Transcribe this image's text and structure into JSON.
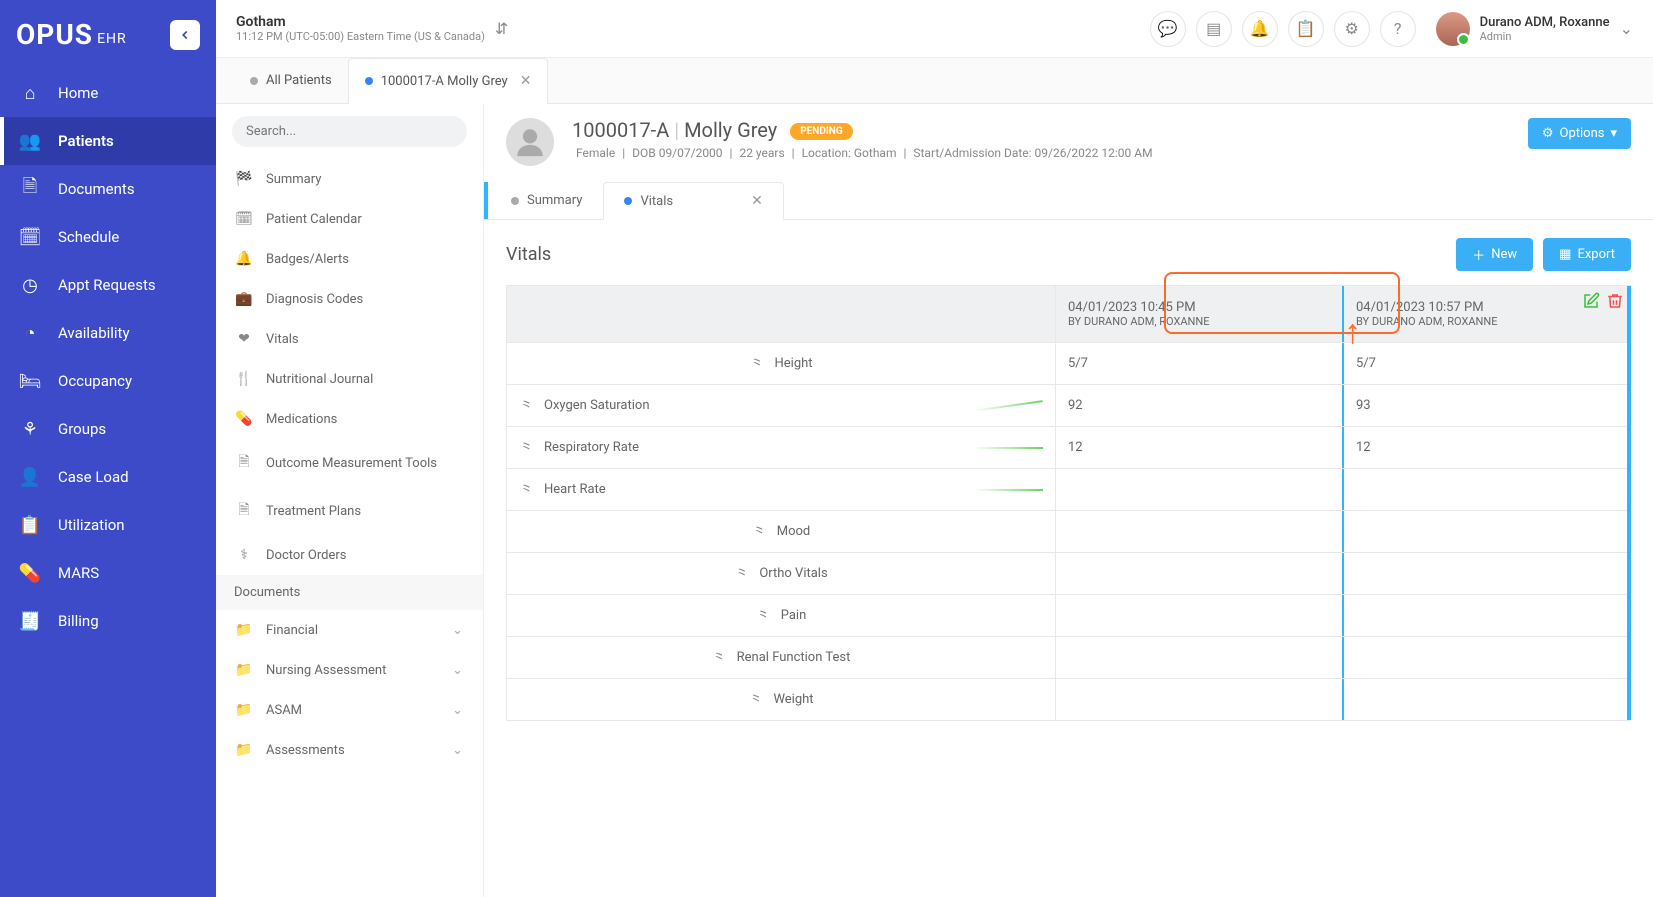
{
  "brand": {
    "name": "OPUS",
    "suffix": "EHR"
  },
  "location": {
    "name": "Gotham",
    "tz": "11:12 PM (UTC-05:00) Eastern Time (US & Canada)"
  },
  "user": {
    "name": "Durano ADM, Roxanne",
    "role": "Admin"
  },
  "nav": {
    "home": "Home",
    "patients": "Patients",
    "documents": "Documents",
    "schedule": "Schedule",
    "appt": "Appt Requests",
    "availability": "Availability",
    "occupancy": "Occupancy",
    "groups": "Groups",
    "caseload": "Case Load",
    "utilization": "Utilization",
    "mars": "MARS",
    "billing": "Billing"
  },
  "tabs": {
    "all": "All Patients",
    "patient": "1000017-A Molly Grey"
  },
  "search": {
    "placeholder": "Search..."
  },
  "subside": {
    "summary": "Summary",
    "calendar": "Patient Calendar",
    "badges": "Badges/Alerts",
    "dx": "Diagnosis Codes",
    "vitals": "Vitals",
    "nutrition": "Nutritional Journal",
    "meds": "Medications",
    "outcome": "Outcome Measurement Tools",
    "tx": "Treatment Plans",
    "orders": "Doctor Orders",
    "docs_header": "Documents",
    "financial": "Financial",
    "nursing": "Nursing Assessment",
    "asam": "ASAM",
    "assess": "Assessments"
  },
  "patient": {
    "id": "1000017-A",
    "name": "Molly Grey",
    "status": "PENDING",
    "sex": "Female",
    "dob": "DOB 09/07/2000",
    "age": "22 years",
    "loc": "Location: Gotham",
    "admit": "Start/Admission Date: 09/26/2022 12:00 AM",
    "options": "Options"
  },
  "inner_tabs": {
    "summary": "Summary",
    "vitals": "Vitals"
  },
  "vitals": {
    "title": "Vitals",
    "new": "New",
    "export": "Export",
    "cols": [
      {
        "ts": "04/01/2023 10:45 PM",
        "by": "BY DURANO ADM, ROXANNE"
      },
      {
        "ts": "04/01/2023 10:57 PM",
        "by": "BY DURANO ADM, ROXANNE"
      }
    ],
    "rows": [
      {
        "label": "Height",
        "v": [
          "5/7",
          "5/7"
        ],
        "spark": ""
      },
      {
        "label": "Oxygen Saturation",
        "v": [
          "92",
          "93"
        ],
        "spark": "up"
      },
      {
        "label": "Respiratory Rate",
        "v": [
          "12",
          "12"
        ],
        "spark": "flat"
      },
      {
        "label": "Heart Rate",
        "v": [
          "",
          ""
        ],
        "spark": "flat"
      },
      {
        "label": "Mood",
        "v": [
          "",
          ""
        ],
        "spark": ""
      },
      {
        "label": "Ortho Vitals",
        "v": [
          "",
          ""
        ],
        "spark": ""
      },
      {
        "label": "Pain",
        "v": [
          "",
          ""
        ],
        "spark": ""
      },
      {
        "label": "Renal Function Test",
        "v": [
          "",
          ""
        ],
        "spark": ""
      },
      {
        "label": "Weight",
        "v": [
          "",
          ""
        ],
        "spark": ""
      }
    ]
  }
}
